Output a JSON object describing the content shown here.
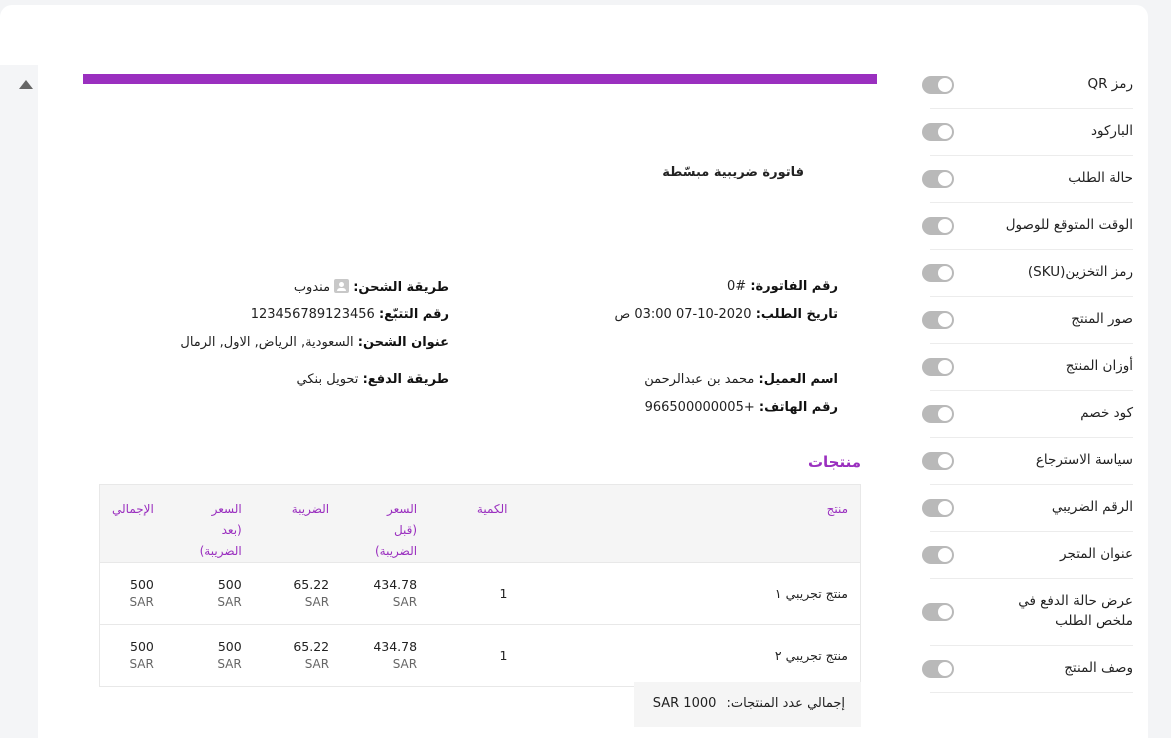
{
  "settings": [
    {
      "label": "رمز QR",
      "enabled": false
    },
    {
      "label": "الباركود",
      "enabled": false
    },
    {
      "label": "حالة الطلب",
      "enabled": false
    },
    {
      "label": "الوقت المتوقع للوصول",
      "enabled": false
    },
    {
      "label": "رمز التخزين(SKU)",
      "enabled": false
    },
    {
      "label": "صور المنتج",
      "enabled": false
    },
    {
      "label": "أوزان المنتج",
      "enabled": false
    },
    {
      "label": "كود خصم",
      "enabled": false
    },
    {
      "label": "سياسة الاسترجاع",
      "enabled": false
    },
    {
      "label": "الرقم الضريبي",
      "enabled": false
    },
    {
      "label": "عنوان المتجر",
      "enabled": false
    },
    {
      "label": "عرض حالة الدفع في ملخص الطلب",
      "enabled": false
    },
    {
      "label": "وصف المنتج",
      "enabled": false
    }
  ],
  "invoice": {
    "title": "فاتورة ضريبية مبسّطة",
    "invoice_number_label": "رقم الفاتورة:",
    "invoice_number": "#0",
    "order_date_label": "تاريخ الطلب:",
    "order_date": "2020-10-07 03:00 ص",
    "customer_name_label": "اسم العميل:",
    "customer_name": "محمد بن عبدالرحمن",
    "phone_label": "رقم الهاتف:",
    "phone": "+966500000005",
    "shipping_method_label": "طريقة الشحن:",
    "shipping_method": "مندوب",
    "tracking_label": "رقم التتبّع:",
    "tracking": "123456789123456",
    "shipping_address_label": "عنوان الشحن:",
    "shipping_address": "السعودية, الرياض, الاول, الرمال",
    "payment_method_label": "طريقة الدفع:",
    "payment_method": "تحويل بنكي"
  },
  "products": {
    "section_title": "منتجات",
    "headers": {
      "product": "منتج",
      "quantity": "الكمية",
      "price": "السعر",
      "price_note": "(قبل الضريبة)",
      "tax": "الضريبة",
      "price_after": "السعر",
      "price_after_note": "(بعد الضريبة)",
      "total": "الإجمالي"
    },
    "rows": [
      {
        "name": "منتج تجريبي ١",
        "qty": "1",
        "price": "434.78",
        "tax": "65.22",
        "price_after": "500",
        "total": "500",
        "currency": "SAR"
      },
      {
        "name": "منتج تجريبي ٢",
        "qty": "1",
        "price": "434.78",
        "tax": "65.22",
        "price_after": "500",
        "total": "500",
        "currency": "SAR"
      }
    ],
    "total_label": "إجمالي عدد المنتجات:",
    "total_value": "SAR 1000"
  },
  "colors": {
    "accent": "#9a2fbf",
    "toggle_off": "#b9b9b9"
  }
}
